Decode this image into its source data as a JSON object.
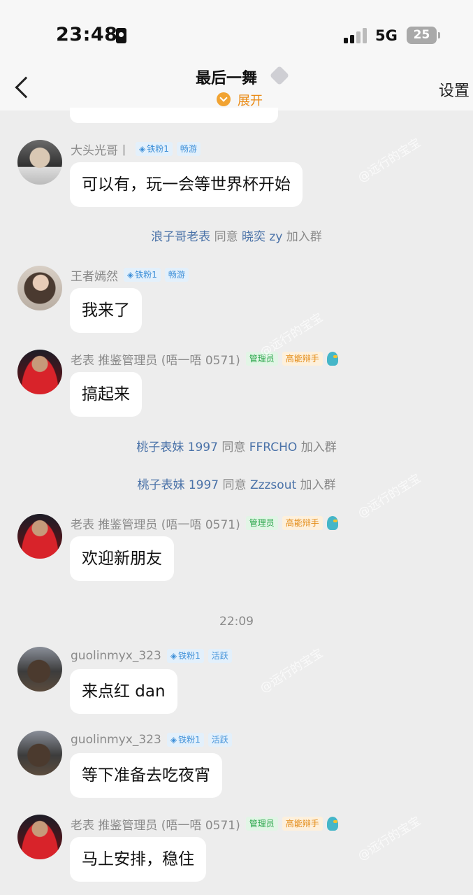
{
  "status": {
    "time": "23:48",
    "network": "5G",
    "battery": "25"
  },
  "header": {
    "title": "最后一舞",
    "expand_label": "展开",
    "settings_label": "设置"
  },
  "messages": [
    {
      "sender": "大头光哥丨",
      "tags": [
        "铁粉1",
        "畅游"
      ],
      "text": "可以有，玩一会等世界杯开始"
    },
    {
      "sender": "王者嫣然",
      "tags": [
        "铁粉1",
        "畅游"
      ],
      "text": "我来了"
    },
    {
      "sender": "老表 推鉴管理员 (唔一唔 0571)",
      "tags": [
        "管理员",
        "高能辩手"
      ],
      "text": "搞起来"
    },
    {
      "sender": "老表 推鉴管理员 (唔一唔 0571)",
      "tags": [
        "管理员",
        "高能辩手"
      ],
      "text": "欢迎新朋友"
    },
    {
      "sender": "guolinmyx_323",
      "tags": [
        "铁粉1",
        "活跃"
      ],
      "text": "来点红 dan"
    },
    {
      "sender": "guolinmyx_323",
      "tags": [
        "铁粉1",
        "活跃"
      ],
      "text": "等下准备去吃夜宵"
    },
    {
      "sender": "老表 推鉴管理员 (唔一唔 0571)",
      "tags": [
        "管理员",
        "高能辩手"
      ],
      "text": "马上安排，稳住"
    }
  ],
  "system_events": [
    {
      "inviter": "浪子哥老表",
      "verb": "同意",
      "invitee": "晓奕 zy",
      "action": "加入群"
    },
    {
      "inviter": "桃子表妹 1997",
      "verb": "同意",
      "invitee": "FFRCHO",
      "action": "加入群"
    },
    {
      "inviter": "桃子表妹 1997",
      "verb": "同意",
      "invitee": "Zzzsout",
      "action": "加入群"
    }
  ],
  "time_divider": "22:09",
  "watermark": "@远行的宝宝",
  "colors": {
    "background": "#ededed",
    "accent_orange": "#ea8a14",
    "link_blue": "#4a72a8"
  }
}
